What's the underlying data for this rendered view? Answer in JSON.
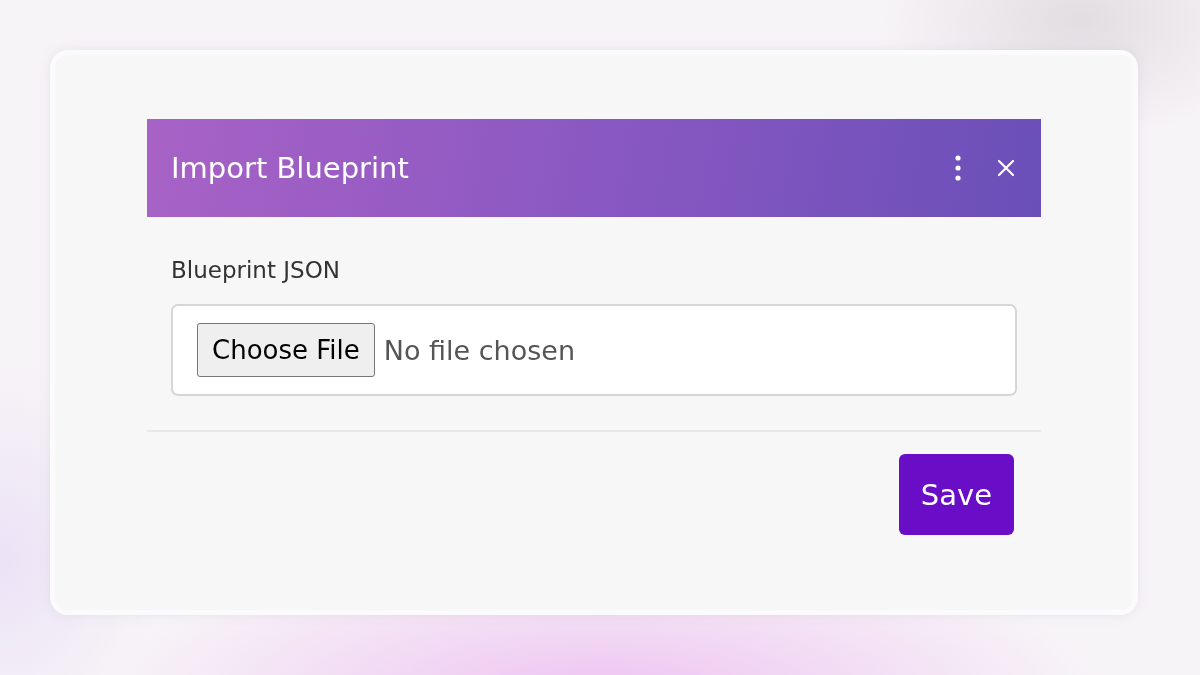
{
  "dialog": {
    "title": "Import Blueprint",
    "field": {
      "label": "Blueprint JSON",
      "button": "Choose File",
      "status": "No file chosen"
    },
    "buttons": [
      "Save"
    ]
  }
}
